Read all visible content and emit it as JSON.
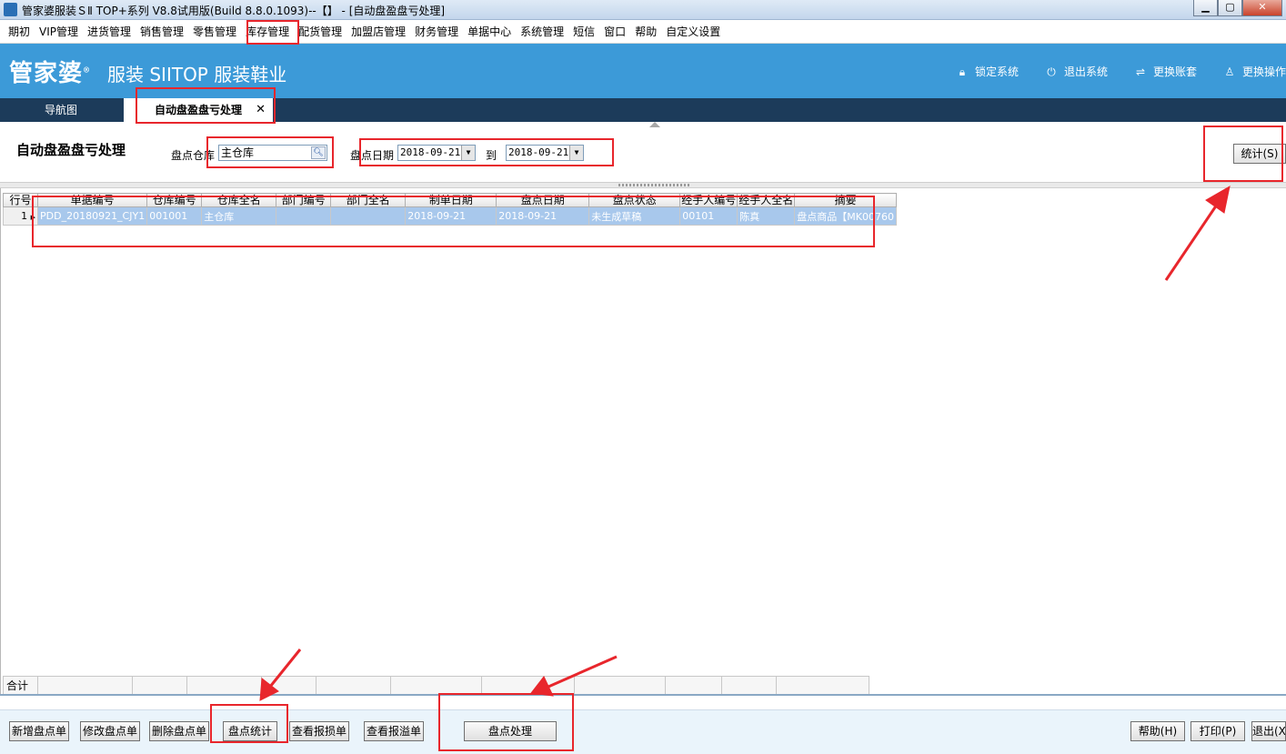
{
  "window": {
    "title": "管家婆服装ＳⅡ TOP+系列 V8.8试用版(Build 8.8.0.1093)--【】 - [自动盘盈盘亏处理]",
    "min_label": "▁",
    "max_label": "▢",
    "close_label": "✕"
  },
  "menu": [
    "期初",
    "VIP管理",
    "进货管理",
    "销售管理",
    "零售管理",
    "库存管理",
    "配货管理",
    "加盟店管理",
    "财务管理",
    "单据中心",
    "系统管理",
    "短信",
    "窗口",
    "帮助",
    "自定义设置"
  ],
  "banner": {
    "logo": "管家婆",
    "logo_mark": "®",
    "product": "服装 SIITOP  服装鞋业",
    "actions": [
      {
        "label": "锁定系统",
        "icon": "lock-icon",
        "glyph": "🔒︎"
      },
      {
        "label": "退出系统",
        "icon": "power-icon",
        "glyph": "⏻"
      },
      {
        "label": "更换账套",
        "icon": "swap-icon",
        "glyph": "⇌"
      },
      {
        "label": "更换操作",
        "icon": "user-icon",
        "glyph": "♙"
      }
    ]
  },
  "tabs": {
    "nav_label": "导航图",
    "active_label": "自动盘盈盘亏处理",
    "close_glyph": "✕"
  },
  "form": {
    "page_title": "自动盘盈盘亏处理",
    "warehouse_label": "盘点仓库",
    "warehouse_value": "主仓库",
    "lookup_glyph": "🔍︎",
    "date_label": "盘点日期",
    "date_from": "2018-09-21",
    "to_label": "到",
    "date_to": "2018-09-21",
    "dropdown_glyph": "▼",
    "stat_button": "统计(S)"
  },
  "grid": {
    "columns": [
      "行号",
      "单据编号",
      "仓库编号",
      "仓库全名",
      "部门编号",
      "部门全名",
      "制单日期",
      "盘点日期",
      "盘点状态",
      "经手人编号",
      "经手人全名",
      "摘要"
    ],
    "rows": [
      {
        "rownum": "1",
        "cells": [
          "PDD_20180921_CJY1",
          "001001",
          "主仓库",
          "",
          "",
          "2018-09-21",
          "2018-09-21",
          "未生成草稿",
          "00101",
          "陈真",
          "盘点商品【MK00760"
        ]
      }
    ],
    "total_label": "合计"
  },
  "toolbar": {
    "new": "新增盘点单",
    "edit": "修改盘点单",
    "delete": "删除盘点单",
    "stat": "盘点统计",
    "view_loss": "查看报损单",
    "view_gain": "查看报溢单",
    "process": "盘点处理",
    "help": "帮助(H)",
    "print": "打印(P)",
    "exit": "退出(X)"
  },
  "colors": {
    "banner": "#3c9ad8",
    "tabbar": "#1c3b5a",
    "highlight": "#e8262c",
    "selected_row": "#a8c8ec"
  }
}
